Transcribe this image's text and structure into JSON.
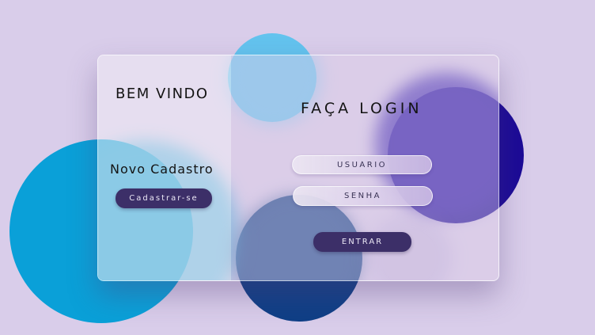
{
  "welcome_panel": {
    "heading": "BEM VINDO",
    "signup_heading": "Novo Cadastro",
    "signup_button": "Cadastrar-se"
  },
  "login_panel": {
    "heading": "FAÇA LOGIN",
    "username_placeholder": "USUÁRIO",
    "password_placeholder": "SENHA",
    "submit_button": "ENTRAR"
  },
  "colors": {
    "background": "#d9cdea",
    "button": "#3c2f68",
    "teal_circle": "#0aa0d8",
    "navy_circle": "#0f3f86",
    "sky_circle": "#63c3ee",
    "indigo_circle": "#1b0a96"
  }
}
